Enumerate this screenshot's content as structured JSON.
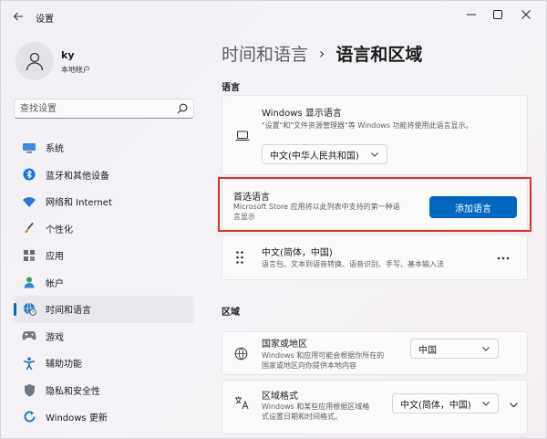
{
  "app": {
    "title": "设置"
  },
  "user": {
    "name": "ky",
    "account_type": "本地帐户"
  },
  "search": {
    "placeholder": "查找设置"
  },
  "sidebar": {
    "items": [
      {
        "label": "系统",
        "icon": "monitor-icon"
      },
      {
        "label": "蓝牙和其他设备",
        "icon": "bluetooth-icon"
      },
      {
        "label": "网络和 Internet",
        "icon": "wifi-icon"
      },
      {
        "label": "个性化",
        "icon": "paint-brush-icon"
      },
      {
        "label": "应用",
        "icon": "apps-icon"
      },
      {
        "label": "帐户",
        "icon": "person-icon"
      },
      {
        "label": "时间和语言",
        "icon": "globe-clock-icon",
        "active": true
      },
      {
        "label": "游戏",
        "icon": "gamepad-icon"
      },
      {
        "label": "辅助功能",
        "icon": "accessibility-icon"
      },
      {
        "label": "隐私和安全性",
        "icon": "shield-icon"
      },
      {
        "label": "Windows 更新",
        "icon": "update-icon"
      }
    ]
  },
  "breadcrumb": {
    "parent": "时间和语言",
    "separator": "›",
    "current": "语言和区域"
  },
  "language_section": {
    "title": "语言",
    "display_language": {
      "title": "Windows 显示语言",
      "desc": "\"设置\"和\"文件资源管理器\"等 Windows 功能将使用此语言显示。",
      "value": "中文(中华人民共和国)"
    },
    "preferred": {
      "title": "首选语言",
      "desc_line1": "Microsoft Store 应用将以此列表中支持的第一种语",
      "desc_line2": "言显示",
      "button": "添加语言"
    },
    "installed": {
      "title": "中文(简体，中国)",
      "desc": "语言包、文本到语音转换、语音识别、手写、基本输入法"
    }
  },
  "region_section": {
    "title": "区域",
    "country": {
      "title": "国家或地区",
      "desc_line1": "Windows 和应用可能会根据你所在的",
      "desc_line2": "国家或地区向你提供本地内容",
      "value": "中国"
    },
    "format": {
      "title": "区域格式",
      "desc_line1": "Windows 和某些应用根据区域格",
      "desc_line2": "式设置日期和时间格式。",
      "value": "中文(简体，中国)"
    }
  },
  "colors": {
    "accent": "#0067c0",
    "highlight": "#e0302a"
  }
}
